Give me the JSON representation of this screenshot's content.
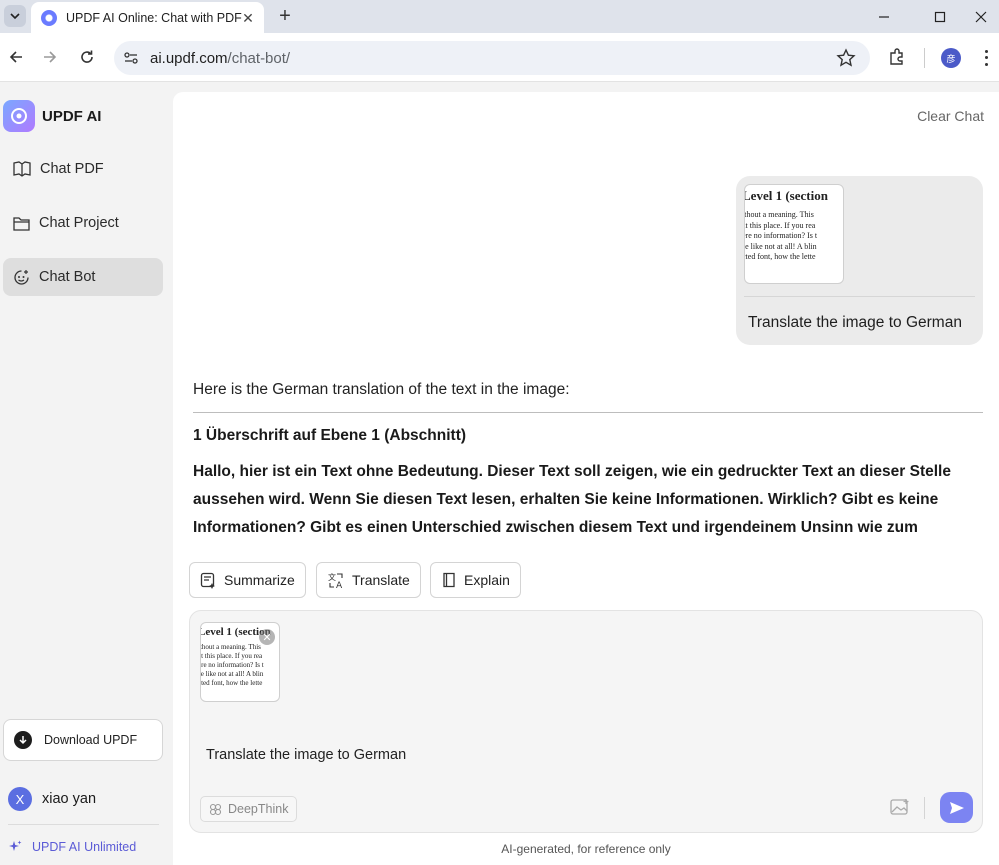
{
  "browser": {
    "tab_title": "UPDF AI Online: Chat with PDF",
    "url_host": "ai.updf.com",
    "url_path": "/chat-bot/",
    "profile_initial": "彦"
  },
  "sidebar": {
    "brand": "UPDF AI",
    "items": [
      {
        "label": "Chat PDF",
        "icon": "book-open-icon"
      },
      {
        "label": "Chat Project",
        "icon": "folder-icon"
      },
      {
        "label": "Chat Bot",
        "icon": "bot-icon",
        "active": true
      }
    ],
    "download_label": "Download UPDF",
    "user": {
      "initial": "X",
      "name": "xiao yan"
    },
    "unlimited_label": "UPDF AI Unlimited"
  },
  "main": {
    "clear_chat": "Clear Chat",
    "user_message": "Translate the image to German",
    "thumbnail": {
      "title": "Level 1 (section",
      "lines": [
        "ithout a meaning. This",
        "at this place. If you rea",
        "ere no information? Is t",
        "se like not at all! A blin",
        "cted font, how the lette"
      ]
    },
    "answer": {
      "intro": "Here is the German translation of the text in the image:",
      "heading": "1 Überschrift auf Ebene 1 (Abschnitt)",
      "body": "Hallo, hier ist ein Text ohne Bedeutung. Dieser Text soll zeigen, wie ein gedruckter Text an dieser Stelle aussehen wird. Wenn Sie diesen Text lesen, erhalten Sie keine Informationen. Wirklich? Gibt es keine Informationen? Gibt es einen Unterschied zwischen diesem Text und irgendeinem Unsinn wie zum"
    },
    "actions": {
      "summarize": "Summarize",
      "translate": "Translate",
      "explain": "Explain"
    },
    "composer": {
      "input_value": "Translate the image to German",
      "deepthink_label": "DeepThink"
    },
    "footnote": "AI-generated, for reference only"
  },
  "colors": {
    "accent": "#7c84f2",
    "brand_link": "#5b5bd6"
  }
}
